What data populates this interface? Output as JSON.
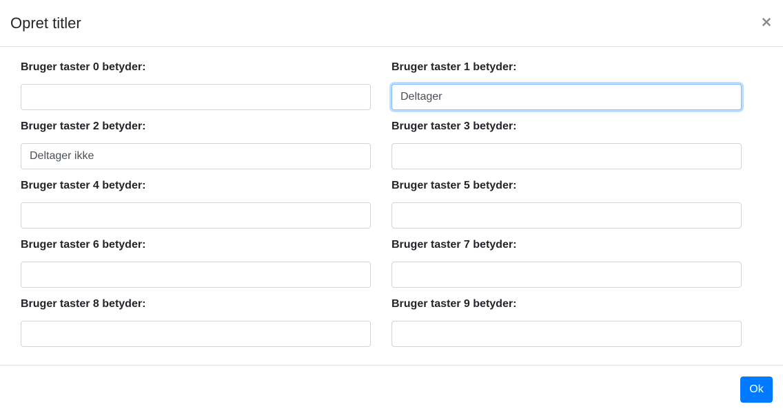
{
  "modal": {
    "title": "Opret titler",
    "close_icon": "close-icon",
    "ok_label": "Ok"
  },
  "fields": [
    {
      "label": "Bruger taster 0 betyder:",
      "value": ""
    },
    {
      "label": "Bruger taster 1 betyder:",
      "value": "Deltager",
      "focused": true
    },
    {
      "label": "Bruger taster 2 betyder:",
      "value": "Deltager ikke"
    },
    {
      "label": "Bruger taster 3 betyder:",
      "value": ""
    },
    {
      "label": "Bruger taster 4 betyder:",
      "value": ""
    },
    {
      "label": "Bruger taster 5 betyder:",
      "value": ""
    },
    {
      "label": "Bruger taster 6 betyder:",
      "value": ""
    },
    {
      "label": "Bruger taster 7 betyder:",
      "value": ""
    },
    {
      "label": "Bruger taster 8 betyder:",
      "value": ""
    },
    {
      "label": "Bruger taster 9 betyder:",
      "value": ""
    }
  ],
  "colors": {
    "primary": "#007bff",
    "focus_border": "#80bdff",
    "border": "#ced4da",
    "divider": "#dee2e6"
  }
}
